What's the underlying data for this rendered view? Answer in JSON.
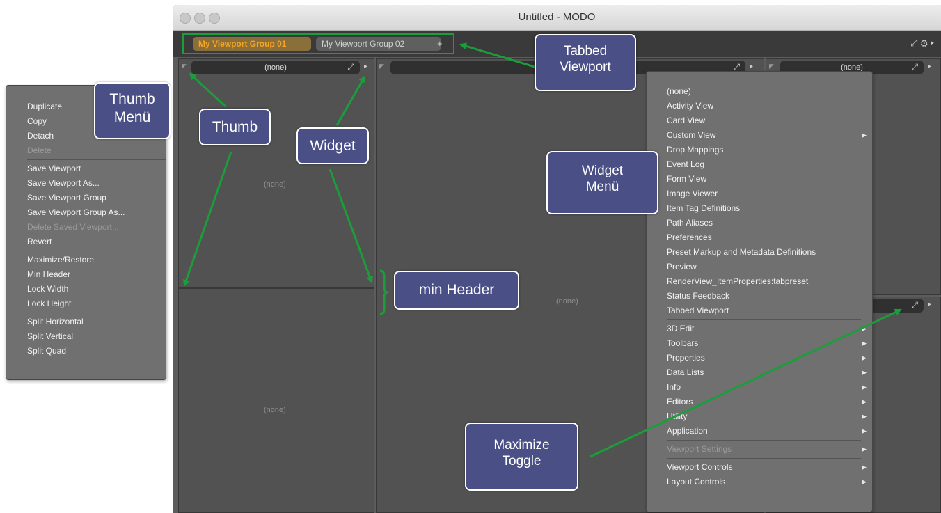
{
  "window": {
    "title": "Untitled - MODO"
  },
  "tabs": [
    {
      "label": "My Viewport Group 01"
    },
    {
      "label": "My Viewport Group 02"
    }
  ],
  "tab_add_label": "+",
  "panels": {
    "top_left_header": "(none)",
    "top_left_body": "(none)",
    "bottom_left_body": "(none)",
    "center_header": "(none)",
    "center_body": "(none)",
    "right_header": "(none)"
  },
  "thumb_menu": {
    "groups": [
      [
        {
          "label": "Duplicate"
        },
        {
          "label": "Copy"
        },
        {
          "label": "Detach"
        },
        {
          "label": "Delete",
          "disabled": true
        }
      ],
      [
        {
          "label": "Save Viewport"
        },
        {
          "label": "Save Viewport As..."
        },
        {
          "label": "Save Viewport Group"
        },
        {
          "label": "Save Viewport Group As..."
        },
        {
          "label": "Delete Saved Viewport...",
          "disabled": true
        },
        {
          "label": "Revert"
        }
      ],
      [
        {
          "label": "Maximize/Restore"
        },
        {
          "label": "Min Header"
        },
        {
          "label": "Lock Width"
        },
        {
          "label": "Lock Height"
        }
      ],
      [
        {
          "label": "Split Horizontal"
        },
        {
          "label": "Split Vertical"
        },
        {
          "label": "Split Quad"
        }
      ]
    ]
  },
  "widget_menu": {
    "groups": [
      [
        {
          "label": "(none)"
        },
        {
          "label": "Activity View"
        },
        {
          "label": "Card View"
        },
        {
          "label": "Custom View",
          "submenu": true
        },
        {
          "label": "Drop Mappings"
        },
        {
          "label": "Event Log"
        },
        {
          "label": "Form View"
        },
        {
          "label": "Image Viewer"
        },
        {
          "label": "Item Tag Definitions"
        },
        {
          "label": "Path Aliases"
        },
        {
          "label": "Preferences"
        },
        {
          "label": "Preset Markup and Metadata Definitions"
        },
        {
          "label": "Preview"
        },
        {
          "label": "RenderView_ItemProperties:tabpreset"
        },
        {
          "label": "Status Feedback"
        },
        {
          "label": "Tabbed Viewport"
        }
      ],
      [
        {
          "label": "3D Edit",
          "submenu": true
        },
        {
          "label": "Toolbars",
          "submenu": true
        },
        {
          "label": "Properties",
          "submenu": true
        },
        {
          "label": "Data Lists",
          "submenu": true
        },
        {
          "label": "Info",
          "submenu": true
        },
        {
          "label": "Editors",
          "submenu": true
        },
        {
          "label": "Utility",
          "submenu": true
        },
        {
          "label": "Application",
          "submenu": true
        }
      ],
      [
        {
          "label": "Viewport Settings",
          "submenu": true,
          "disabled": true
        }
      ],
      [
        {
          "label": "Viewport Controls",
          "submenu": true
        },
        {
          "label": "Layout Controls",
          "submenu": true
        }
      ]
    ]
  },
  "callouts": {
    "thumb_menu": [
      "Thumb",
      "Menü"
    ],
    "thumb": "Thumb",
    "widget": "Widget",
    "tabbed_viewport": [
      "Tabbed",
      "Viewport"
    ],
    "widget_menu": [
      "Widget",
      "Menü"
    ],
    "min_header": "min Header",
    "maximize_toggle": [
      "Maximize",
      "Toggle"
    ]
  },
  "colors": {
    "annotation": "#1a9e3a",
    "callout_fill": "#4a4f86",
    "active_tab_text": "#f5a623"
  }
}
